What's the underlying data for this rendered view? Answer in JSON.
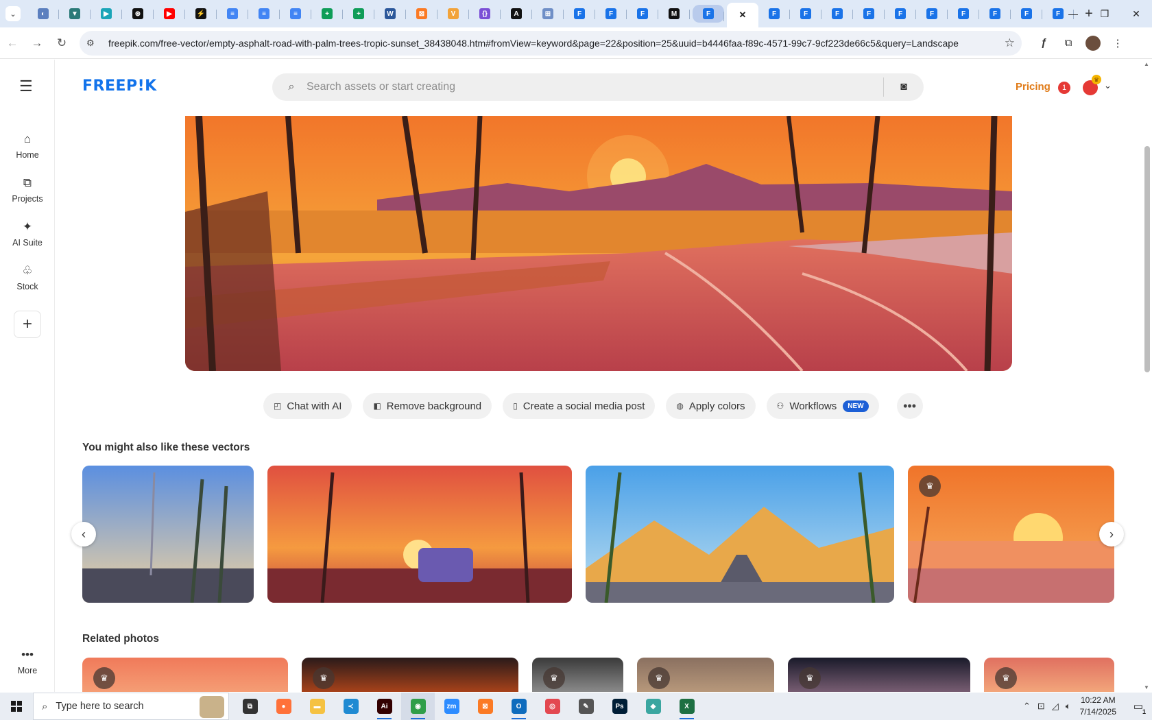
{
  "browser": {
    "tabs": [
      {
        "icon": "globe-icon",
        "color": "#5b7fbf",
        "glyph": "◐"
      },
      {
        "icon": "shield-icon",
        "color": "#2b7a78",
        "glyph": "▼"
      },
      {
        "icon": "arrow-icon",
        "color": "#1aa5b8",
        "glyph": "▶"
      },
      {
        "icon": "openai-icon",
        "color": "#111111",
        "glyph": "⊛"
      },
      {
        "icon": "youtube-icon",
        "color": "#ff0000",
        "glyph": "▶"
      },
      {
        "icon": "bolt-icon",
        "color": "#111111",
        "glyph": "⚡"
      },
      {
        "icon": "docs-icon",
        "color": "#4285f4",
        "glyph": "≡"
      },
      {
        "icon": "docs-icon",
        "color": "#4285f4",
        "glyph": "≡"
      },
      {
        "icon": "docs-icon",
        "color": "#4285f4",
        "glyph": "≡"
      },
      {
        "icon": "sheets-icon",
        "color": "#0f9d58",
        "glyph": "+"
      },
      {
        "icon": "sheets-icon",
        "color": "#0f9d58",
        "glyph": "+"
      },
      {
        "icon": "word-icon",
        "color": "#2b579a",
        "glyph": "W"
      },
      {
        "icon": "xampp-icon",
        "color": "#fb7a24",
        "glyph": "⊠"
      },
      {
        "icon": "vee-icon",
        "color": "#f2a33a",
        "glyph": "V"
      },
      {
        "icon": "braces-icon",
        "color": "#7b4fd6",
        "glyph": "{}"
      },
      {
        "icon": "adobe-icon",
        "color": "#111111",
        "glyph": "A"
      },
      {
        "icon": "grid-icon",
        "color": "#6f8fc7",
        "glyph": "⊞"
      },
      {
        "icon": "forms-icon",
        "color": "#1a73e8",
        "glyph": "F"
      },
      {
        "icon": "forms-icon",
        "color": "#1a73e8",
        "glyph": "F"
      },
      {
        "icon": "forms-icon",
        "color": "#1a73e8",
        "glyph": "F"
      },
      {
        "icon": "medium-icon",
        "color": "#111111",
        "glyph": "M"
      },
      {
        "icon": "forms-icon",
        "color": "#1a73e8",
        "glyph": "F",
        "state": "highlighted"
      },
      {
        "icon": "close-icon",
        "color": "#222222",
        "glyph": "✕",
        "state": "active"
      },
      {
        "icon": "forms-icon",
        "color": "#1a73e8",
        "glyph": "F"
      },
      {
        "icon": "forms-icon",
        "color": "#1a73e8",
        "glyph": "F"
      },
      {
        "icon": "forms-icon",
        "color": "#1a73e8",
        "glyph": "F"
      },
      {
        "icon": "forms-icon",
        "color": "#1a73e8",
        "glyph": "F"
      },
      {
        "icon": "forms-icon",
        "color": "#1a73e8",
        "glyph": "F"
      },
      {
        "icon": "forms-icon",
        "color": "#1a73e8",
        "glyph": "F"
      },
      {
        "icon": "forms-icon",
        "color": "#1a73e8",
        "glyph": "F"
      },
      {
        "icon": "forms-icon",
        "color": "#1a73e8",
        "glyph": "F"
      },
      {
        "icon": "forms-icon",
        "color": "#1a73e8",
        "glyph": "F"
      },
      {
        "icon": "forms-icon",
        "color": "#1a73e8",
        "glyph": "F"
      }
    ],
    "url": "freepik.com/free-vector/empty-asphalt-road-with-palm-trees-tropic-sunset_38438048.htm#fromView=keyword&page=22&position=25&uuid=b4446faa-f89c-4571-99c7-9cf223de66c5&query=Landscape"
  },
  "sidebar": {
    "items": [
      {
        "label": "Home",
        "icon": "home-icon"
      },
      {
        "label": "Projects",
        "icon": "projects-icon"
      },
      {
        "label": "AI Suite",
        "icon": "sparkle-icon"
      },
      {
        "label": "Stock",
        "icon": "stock-icon"
      }
    ],
    "more_label": "More"
  },
  "header": {
    "logo": "FREEP!K",
    "search_placeholder": "Search assets or start creating",
    "pricing_label": "Pricing",
    "notification_count": "1"
  },
  "actions": [
    {
      "label": "Chat with AI",
      "icon": "chat-icon"
    },
    {
      "label": "Remove background",
      "icon": "remove-bg-icon"
    },
    {
      "label": "Create a social media post",
      "icon": "phone-icon"
    },
    {
      "label": "Apply colors",
      "icon": "palette-icon"
    },
    {
      "label": "Workflows",
      "icon": "workflow-icon",
      "badge": "NEW"
    }
  ],
  "sections": {
    "similar_title": "You might also like these vectors",
    "related_title": "Related photos"
  },
  "colors": {
    "brand_blue": "#1273eb",
    "pricing_orange": "#e07a16",
    "new_badge": "#1c5fd6"
  },
  "taskbar": {
    "search_text": "Type here to search",
    "apps": [
      {
        "icon": "task-view-icon",
        "color": "#333333",
        "glyph": "⧉"
      },
      {
        "icon": "firefox-icon",
        "color": "#ff7139",
        "glyph": "●"
      },
      {
        "icon": "file-explorer-icon",
        "color": "#f5c242",
        "glyph": "▬"
      },
      {
        "icon": "vscode-icon",
        "color": "#1f8ad2",
        "glyph": "≺"
      },
      {
        "icon": "illustrator-icon",
        "color": "#330000",
        "glyph": "Ai",
        "running": true
      },
      {
        "icon": "chrome-icon",
        "color": "#2f9e49",
        "glyph": "◉",
        "running": true,
        "active": true
      },
      {
        "icon": "zoom-icon",
        "color": "#2d8cff",
        "glyph": "zm"
      },
      {
        "icon": "xampp-icon",
        "color": "#fb7a24",
        "glyph": "⊠"
      },
      {
        "icon": "outlook-icon",
        "color": "#0f6cbd",
        "glyph": "O",
        "running": true
      },
      {
        "icon": "creative-cloud-icon",
        "color": "#e34850",
        "glyph": "◎"
      },
      {
        "icon": "pen-icon",
        "color": "#555555",
        "glyph": "✎"
      },
      {
        "icon": "photoshop-icon",
        "color": "#001e36",
        "glyph": "Ps"
      },
      {
        "icon": "app-icon",
        "color": "#3aa6a0",
        "glyph": "◆"
      },
      {
        "icon": "excel-icon",
        "color": "#1d6f42",
        "glyph": "X",
        "running": true
      }
    ],
    "time": "10:22 AM",
    "date": "7/14/2025",
    "notification_count": "1"
  }
}
